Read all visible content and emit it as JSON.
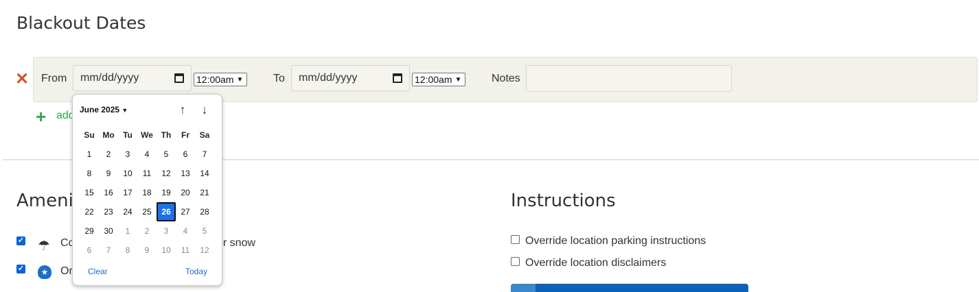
{
  "blackout": {
    "title": "Blackout Dates",
    "from_label": "From",
    "to_label": "To",
    "notes_label": "Notes",
    "date_placeholder": "mm/dd/yyyy",
    "from_time": "12:00am",
    "to_time": "12:00am",
    "notes_value": "",
    "add_label": "add"
  },
  "amenities": {
    "title": "Amenit",
    "items": [
      {
        "label_start": "Co",
        "label_end": "or snow",
        "checked": true,
        "icon": "umbrella-icon"
      },
      {
        "label_start": "Or",
        "label_end": "",
        "checked": true,
        "icon": "police-badge-icon"
      }
    ]
  },
  "instructions": {
    "title": "Instructions",
    "options": [
      {
        "label": "Override location parking instructions",
        "checked": false
      },
      {
        "label": "Override location disclaimers",
        "checked": false
      }
    ]
  },
  "datepicker": {
    "month_label": "June 2025",
    "weekdays": [
      "Su",
      "Mo",
      "Tu",
      "We",
      "Th",
      "Fr",
      "Sa"
    ],
    "weeks": [
      [
        "1",
        "2",
        "3",
        "4",
        "5",
        "6",
        "7"
      ],
      [
        "8",
        "9",
        "10",
        "11",
        "12",
        "13",
        "14"
      ],
      [
        "15",
        "16",
        "17",
        "18",
        "19",
        "20",
        "21"
      ],
      [
        "22",
        "23",
        "24",
        "25",
        "26",
        "27",
        "28"
      ],
      [
        "29",
        "30",
        "1",
        "2",
        "3",
        "4",
        "5"
      ],
      [
        "6",
        "7",
        "8",
        "9",
        "10",
        "11",
        "12"
      ]
    ],
    "selected_day": "26",
    "clear_label": "Clear",
    "today_label": "Today"
  },
  "colors": {
    "accent_blue": "#1a73e8",
    "remove_red": "#d0562c",
    "add_green": "#2ea84a",
    "panel_bg": "#f2f1ea"
  }
}
